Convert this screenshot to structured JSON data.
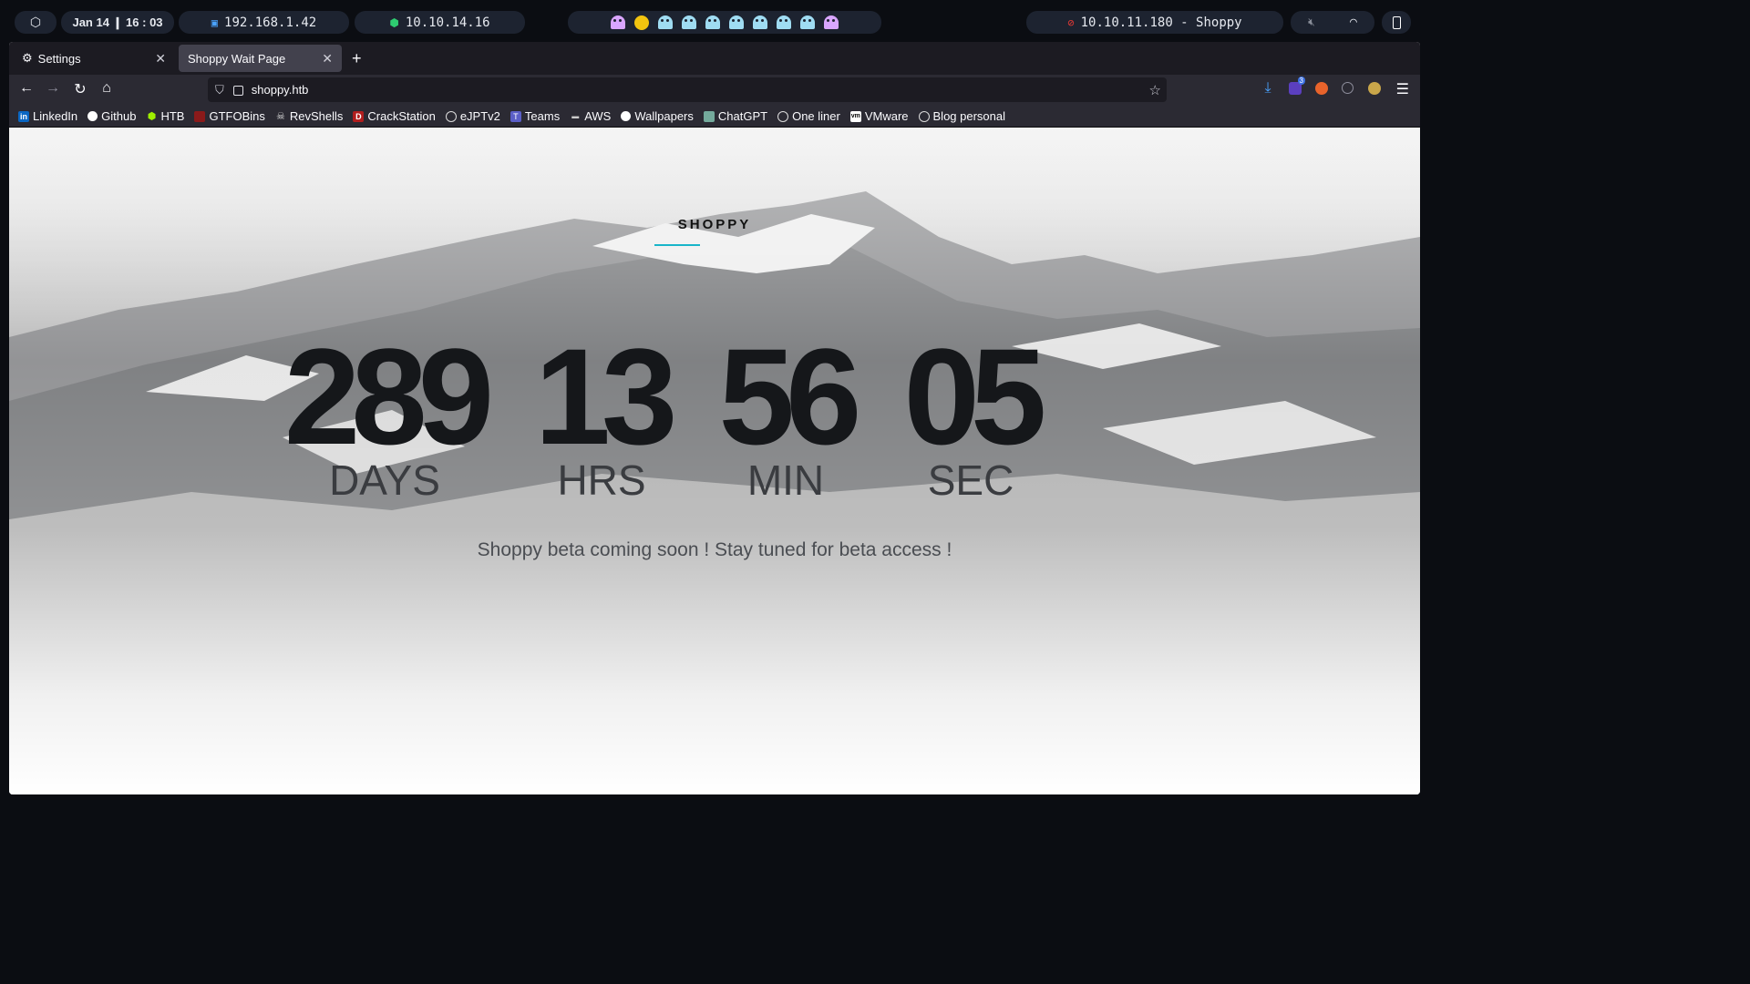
{
  "topbar": {
    "datetime": "Jan 14 ❙ 16 : 03",
    "local_ip": "192.168.1.42",
    "vpn_ip": "10.10.14.16",
    "target": "10.10.11.180 - Shoppy",
    "colors": {
      "ghost_pink": "#d9a6ff",
      "ghost_blue": "#9fdcf2",
      "pacman": "#f2c40f",
      "vpn_green": "#2ecc71",
      "target_red": "#e53935"
    }
  },
  "browser": {
    "tabs": [
      {
        "label": "Settings",
        "icon": "gear-icon"
      },
      {
        "label": "Shoppy Wait Page",
        "icon": ""
      }
    ],
    "url": "shoppy.htb",
    "extension_badge": "3",
    "bookmarks": [
      {
        "label": "LinkedIn",
        "icon": "linkedin-icon"
      },
      {
        "label": "Github",
        "icon": "github-icon"
      },
      {
        "label": "HTB",
        "icon": "htb-icon"
      },
      {
        "label": "GTFOBins",
        "icon": "gtfobins-icon"
      },
      {
        "label": "RevShells",
        "icon": "skull-icon"
      },
      {
        "label": "CrackStation",
        "icon": "crackstation-icon"
      },
      {
        "label": "eJPTv2",
        "icon": "globe-icon"
      },
      {
        "label": "Teams",
        "icon": "teams-icon"
      },
      {
        "label": "AWS",
        "icon": "aws-icon"
      },
      {
        "label": "Wallpapers",
        "icon": "github-icon"
      },
      {
        "label": "ChatGPT",
        "icon": "chatgpt-icon"
      },
      {
        "label": "One liner",
        "icon": "globe-icon"
      },
      {
        "label": "VMware",
        "icon": "vmware-icon"
      },
      {
        "label": "Blog personal",
        "icon": "globe-icon"
      }
    ]
  },
  "page": {
    "brand": "SHOPPY",
    "accent_color": "#19b5c9",
    "countdown": [
      {
        "value": "289",
        "label": "DAYS"
      },
      {
        "value": "13",
        "label": "HRS"
      },
      {
        "value": "56",
        "label": "MIN"
      },
      {
        "value": "05",
        "label": "SEC"
      }
    ],
    "tagline": "Shoppy beta coming soon ! Stay tuned for beta access !"
  }
}
